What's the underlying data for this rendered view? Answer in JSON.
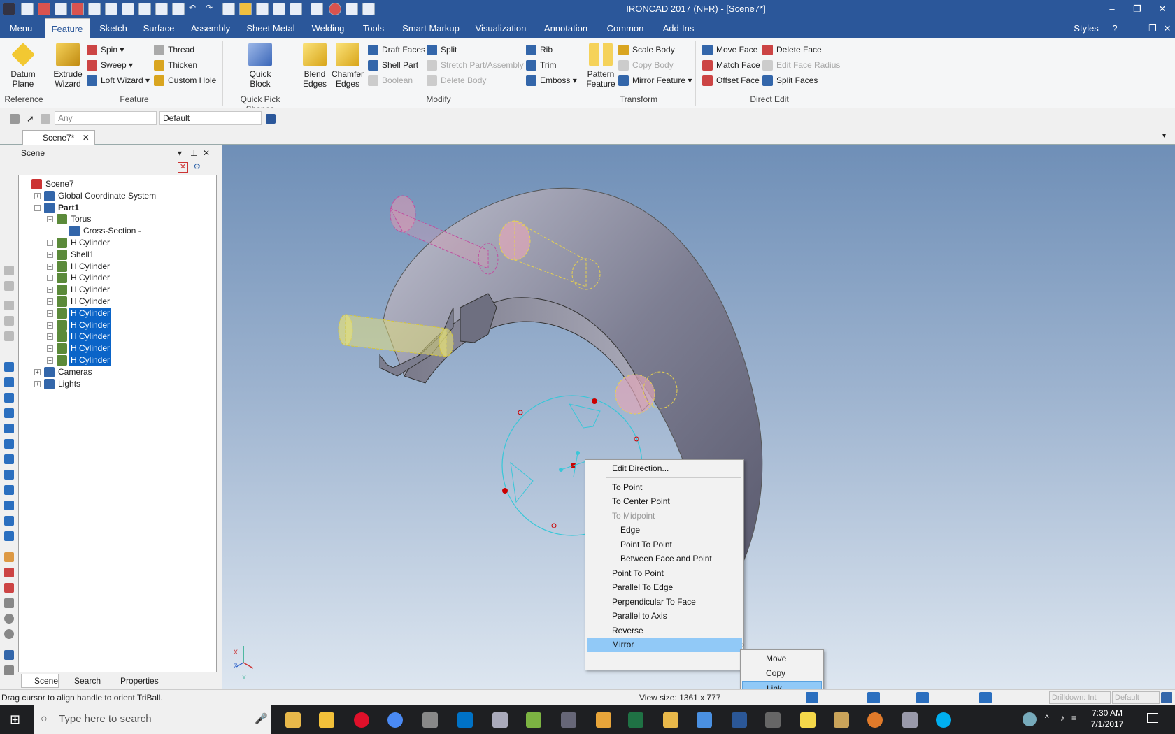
{
  "title_bar": {
    "title": "IRONCAD 2017 (NFR) - [Scene7*]",
    "minimize": "–",
    "restore": "❐",
    "close": "✕"
  },
  "menu_tabs": [
    {
      "label": "Menu"
    },
    {
      "label": "Feature"
    },
    {
      "label": "Sketch"
    },
    {
      "label": "Surface"
    },
    {
      "label": "Assembly"
    },
    {
      "label": "Sheet Metal"
    },
    {
      "label": "Welding"
    },
    {
      "label": "Tools"
    },
    {
      "label": "Smart Markup"
    },
    {
      "label": "Visualization"
    },
    {
      "label": "Annotation"
    },
    {
      "label": "Common"
    },
    {
      "label": "Add-Ins"
    }
  ],
  "styles_label": "Styles",
  "ribbon": {
    "datum_plane": "Datum Plane",
    "extrude_wizard": "Extrude Wizard",
    "spin": "Spin",
    "sweep": "Sweep",
    "loft_wizard": "Loft Wizard",
    "thread": "Thread",
    "thicken": "Thicken",
    "custom_hole": "Custom Hole",
    "quick_block": "Quick Block",
    "blend_edges": "Blend Edges",
    "chamfer_edges": "Chamfer Edges",
    "draft_faces": "Draft Faces",
    "shell_part": "Shell Part",
    "boolean": "Boolean",
    "split": "Split",
    "stretch_part": "Stretch Part/Assembly",
    "delete_body": "Delete Body",
    "rib": "Rib",
    "trim": "Trim",
    "emboss": "Emboss",
    "pattern_feature": "Pattern Feature",
    "scale_body": "Scale Body",
    "copy_body": "Copy Body",
    "mirror_feature": "Mirror Feature",
    "move_face": "Move Face",
    "match_face": "Match Face",
    "offset_face": "Offset Face",
    "delete_face": "Delete Face",
    "edit_face_radius": "Edit Face Radius",
    "split_faces": "Split Faces",
    "groups": {
      "reference": "Reference",
      "feature": "Feature",
      "quick_pick": "Quick Pick Shapes",
      "modify": "Modify",
      "transform": "Transform",
      "direct_edit": "Direct Edit"
    }
  },
  "filter": {
    "selection": "Any",
    "style": "Default"
  },
  "doc_tab": "Scene7*",
  "scene_panel": {
    "title": "Scene",
    "tree": [
      {
        "label": "Scene7",
        "depth": 0,
        "selected": false,
        "bold": false
      },
      {
        "label": "Global Coordinate System",
        "depth": 1,
        "selected": false,
        "bold": false
      },
      {
        "label": "Part1",
        "depth": 1,
        "selected": false,
        "bold": true
      },
      {
        "label": "Torus",
        "depth": 2,
        "selected": false,
        "bold": false
      },
      {
        "label": "Cross-Section -",
        "depth": 3,
        "selected": false,
        "bold": false
      },
      {
        "label": "H Cylinder",
        "depth": 2,
        "selected": false,
        "bold": false
      },
      {
        "label": "Shell1",
        "depth": 2,
        "selected": false,
        "bold": false
      },
      {
        "label": "H Cylinder",
        "depth": 2,
        "selected": false,
        "bold": false
      },
      {
        "label": "H Cylinder",
        "depth": 2,
        "selected": false,
        "bold": false
      },
      {
        "label": "H Cylinder",
        "depth": 2,
        "selected": false,
        "bold": false
      },
      {
        "label": "H Cylinder",
        "depth": 2,
        "selected": false,
        "bold": false
      },
      {
        "label": "H Cylinder",
        "depth": 2,
        "selected": true,
        "bold": false
      },
      {
        "label": "H Cylinder",
        "depth": 2,
        "selected": true,
        "bold": false
      },
      {
        "label": "H Cylinder",
        "depth": 2,
        "selected": true,
        "bold": false
      },
      {
        "label": "H Cylinder",
        "depth": 2,
        "selected": true,
        "bold": false
      },
      {
        "label": "H Cylinder",
        "depth": 2,
        "selected": true,
        "bold": false
      },
      {
        "label": "Cameras",
        "depth": 1,
        "selected": false,
        "bold": false
      },
      {
        "label": "Lights",
        "depth": 1,
        "selected": false,
        "bold": false
      }
    ],
    "tabs": [
      {
        "label": "Scene"
      },
      {
        "label": "Search"
      },
      {
        "label": "Properties"
      }
    ]
  },
  "context_menu": {
    "items": [
      {
        "label": "Edit Direction...",
        "sub": false,
        "disabled": false,
        "highlight": false
      },
      {
        "label": "To Point",
        "sub": false,
        "disabled": false,
        "highlight": false
      },
      {
        "label": "To Center Point",
        "sub": false,
        "disabled": false,
        "highlight": false
      },
      {
        "label": "To Midpoint",
        "sub": false,
        "disabled": true,
        "highlight": false
      },
      {
        "label": "Edge",
        "sub": true,
        "disabled": false,
        "highlight": false
      },
      {
        "label": "Point To Point",
        "sub": true,
        "disabled": false,
        "highlight": false
      },
      {
        "label": "Between Face and Point",
        "sub": true,
        "disabled": false,
        "highlight": false
      },
      {
        "label": "Point To Point",
        "sub": false,
        "disabled": false,
        "highlight": false
      },
      {
        "label": "Parallel To Edge",
        "sub": false,
        "disabled": false,
        "highlight": false
      },
      {
        "label": "Perpendicular To Face",
        "sub": false,
        "disabled": false,
        "highlight": false
      },
      {
        "label": "Parallel to Axis",
        "sub": false,
        "disabled": false,
        "highlight": false
      },
      {
        "label": "Reverse",
        "sub": false,
        "disabled": false,
        "highlight": false
      },
      {
        "label": "Mirror",
        "sub": false,
        "disabled": false,
        "highlight": true
      }
    ],
    "submenu": [
      {
        "label": "Move",
        "highlight": false
      },
      {
        "label": "Copy",
        "highlight": false
      },
      {
        "label": "Link",
        "highlight": true
      }
    ]
  },
  "status": {
    "hint": "Drag cursor to align handle to orient TriBall.",
    "view_size": "View size: 1361 x  777",
    "drilldown": "Drilldown: Int",
    "default": "Default"
  },
  "taskbar": {
    "search_placeholder": "Type here to search",
    "time": "7:30 AM",
    "date": "7/1/2017"
  },
  "axis_labels": {
    "x": "X",
    "z": "Z",
    "y": "Y"
  },
  "colors": {
    "accent": "#2b579a",
    "selection": "#0a64c8",
    "menu_highlight": "#91c9f7"
  }
}
